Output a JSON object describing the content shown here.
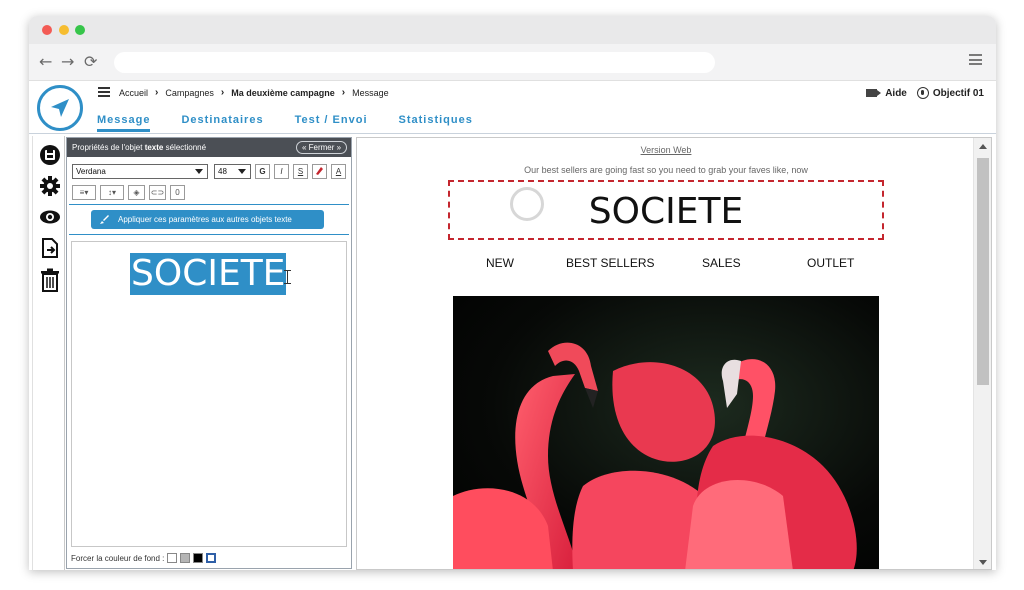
{
  "browser": {
    "back_glyph": "←",
    "forward_glyph": "→",
    "reload_glyph": "⟳",
    "address": ""
  },
  "header": {
    "breadcrumb": [
      "Accueil",
      "Campagnes",
      "Ma deuxième campagne",
      "Message"
    ],
    "help_label": "Aide",
    "user_label": "Objectif 01"
  },
  "tabs": [
    {
      "label": "Message",
      "active": true
    },
    {
      "label": "Destinataires",
      "active": false
    },
    {
      "label": "Test / Envoi",
      "active": false
    },
    {
      "label": "Statistiques",
      "active": false
    }
  ],
  "tools": [
    "save-icon",
    "gear-icon",
    "eye-icon",
    "export-icon",
    "trash-icon"
  ],
  "panel": {
    "title_prefix": "Propriétés de l'objet ",
    "title_strong": "texte",
    "title_suffix": " sélectionné",
    "close_label": "« Fermer »",
    "font": "Verdana",
    "size": "48",
    "bold_label": "G",
    "italic_label": "I",
    "strike_label": "S",
    "text_color_label": "A",
    "indent_value": "0",
    "apply_label": "Appliquer ces paramètres aux autres objets texte",
    "editor_text": "SOCIETE",
    "bg_label": "Forcer la couleur de fond :"
  },
  "preview": {
    "version_web": "Version Web",
    "tagline": "Our best sellers are going fast so you need to grab your faves like, now",
    "logo_text": "SOCIETE",
    "menu": [
      "NEW",
      "BEST SELLERS",
      "SALES",
      "OUTLET"
    ]
  },
  "colors": {
    "accent": "#2f8fc7",
    "selection_border": "#c4262e",
    "panel_header": "#4b4f55"
  }
}
